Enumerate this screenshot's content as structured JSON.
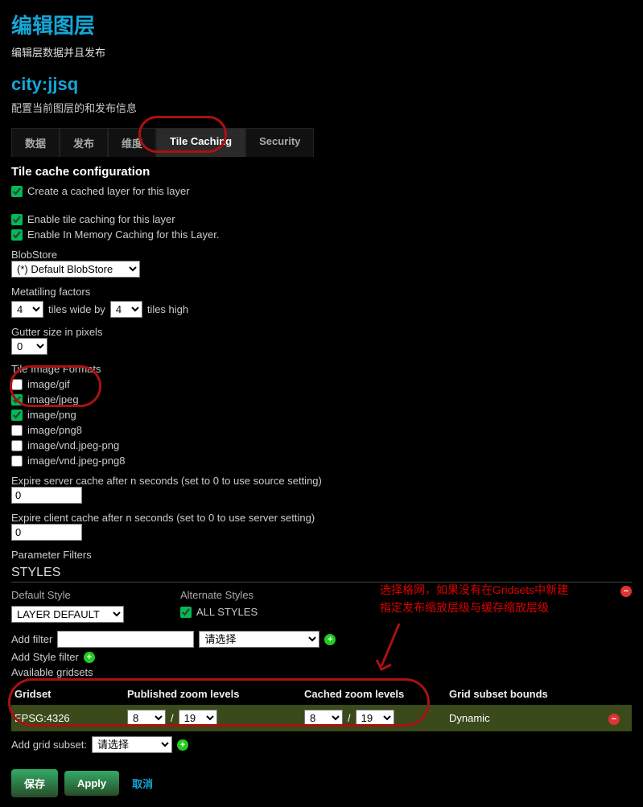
{
  "page": {
    "title": "编辑图层",
    "subtitle": "编辑层数据并且发布",
    "layer_name": "city:jjsq",
    "layer_desc": "配置当前图层的和发布信息"
  },
  "tabs": {
    "data": "数据",
    "publish": "发布",
    "dimensions": "维度",
    "tile_caching": "Tile Caching",
    "security": "Security"
  },
  "section": {
    "tile_config": "Tile cache configuration"
  },
  "checks": {
    "create_cached": "Create a cached layer for this layer",
    "enable_tile": "Enable tile caching for this layer",
    "enable_mem": "Enable In Memory Caching for this Layer."
  },
  "blobstore": {
    "label": "BlobStore",
    "value": "(*) Default BlobStore"
  },
  "metatile": {
    "label": "Metatiling factors",
    "wide_val": "4",
    "wide_text": "tiles wide by",
    "high_val": "4",
    "high_text": "tiles high"
  },
  "gutter": {
    "label": "Gutter size in pixels",
    "value": "0"
  },
  "formats": {
    "label": "Tile Image Formats",
    "gif": "image/gif",
    "jpeg": "image/jpeg",
    "png": "image/png",
    "png8": "image/png8",
    "vndjpegpng": "image/vnd.jpeg-png",
    "vndjpegpng8": "image/vnd.jpeg-png8"
  },
  "expire": {
    "server_label": "Expire server cache after n seconds (set to 0 to use source setting)",
    "server_value": "0",
    "client_label": "Expire client cache after n seconds (set to 0 to use server setting)",
    "client_value": "0"
  },
  "param": {
    "label": "Parameter Filters",
    "styles_head": "STYLES",
    "default_style": "Default Style",
    "alternate": "Alternate Styles",
    "layer_default": "LAYER DEFAULT",
    "all_styles": "ALL STYLES"
  },
  "filters": {
    "add_filter": "Add filter",
    "select_placeholder": "请选择",
    "add_style": "Add Style filter",
    "available": "Available gridsets"
  },
  "gridhead": {
    "gridset": "Gridset",
    "pub": "Published zoom levels",
    "cached": "Cached zoom levels",
    "bounds": "Grid subset bounds"
  },
  "gridrow": {
    "name": "EPSG:4326",
    "pub_min": "8",
    "pub_max": "19",
    "cache_min": "8",
    "cache_max": "19",
    "bounds": "Dynamic",
    "slash": "/"
  },
  "addgrid": {
    "label": "Add grid subset:",
    "placeholder": "请选择"
  },
  "buttons": {
    "save": "保存",
    "apply": "Apply",
    "cancel": "取消"
  },
  "annotation": {
    "line1": "选择格网，如果没有在Gridsets中新建",
    "line2": "指定发布缩放层级与缓存缩放层级"
  }
}
